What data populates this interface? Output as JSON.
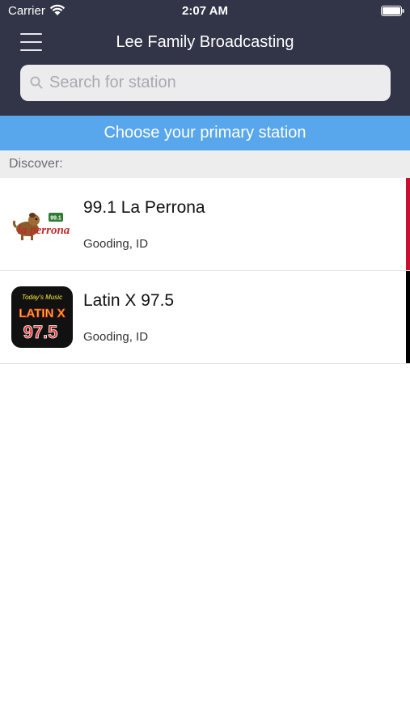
{
  "status_bar": {
    "carrier": "Carrier",
    "time": "2:07 AM"
  },
  "nav": {
    "title": "Lee Family Broadcasting",
    "menu_icon": "hamburger-menu-icon"
  },
  "search": {
    "placeholder": "Search for station",
    "value": "",
    "icon": "search-icon"
  },
  "banner": {
    "label": "Choose your primary station"
  },
  "section": {
    "label": "Discover:"
  },
  "stations": [
    {
      "name": "99.1 La Perrona",
      "location": "Gooding, ID",
      "accent": "#c8102e",
      "logo": "la-perrona-logo",
      "logo_text": "la perrona"
    },
    {
      "name": "Latin X 97.5",
      "location": "Gooding, ID",
      "accent": "#000000",
      "logo": "latin-x-logo",
      "logo_text_top": "Today's Music",
      "logo_text_mid": "LATIN X",
      "logo_text_bottom": "97.5"
    }
  ],
  "colors": {
    "header": "#323448",
    "banner": "#58a6ec",
    "section": "#ededee"
  }
}
